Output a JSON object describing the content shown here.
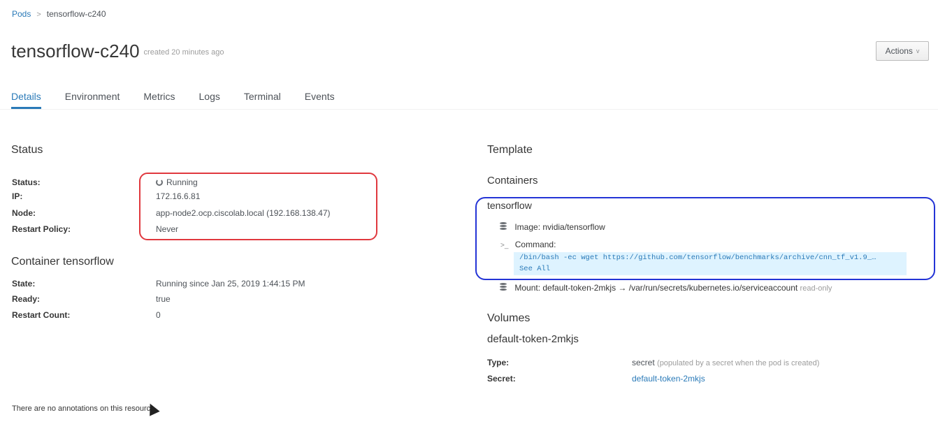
{
  "breadcrumb": {
    "parent": "Pods",
    "separator": ">",
    "current": "tensorflow-c240"
  },
  "header": {
    "title": "tensorflow-c240",
    "created": "created 20 minutes ago",
    "actions_label": "Actions",
    "actions_caret": "v"
  },
  "tabs": [
    {
      "label": "Details",
      "active": true
    },
    {
      "label": "Environment",
      "active": false
    },
    {
      "label": "Metrics",
      "active": false
    },
    {
      "label": "Logs",
      "active": false
    },
    {
      "label": "Terminal",
      "active": false
    },
    {
      "label": "Events",
      "active": false
    }
  ],
  "status_section": {
    "heading": "Status",
    "rows": [
      {
        "label": "Status:",
        "value": "Running"
      },
      {
        "label": "IP:",
        "value": "172.16.6.81"
      },
      {
        "label": "Node:",
        "value": "app-node2.ocp.ciscolab.local (192.168.138.47)"
      },
      {
        "label": "Restart Policy:",
        "value": "Never"
      }
    ]
  },
  "container_section": {
    "heading": "Container tensorflow",
    "rows": [
      {
        "label": "State:",
        "value": "Running since Jan 25, 2019 1:44:15 PM"
      },
      {
        "label": "Ready:",
        "value": "true"
      },
      {
        "label": "Restart Count:",
        "value": "0"
      }
    ]
  },
  "annotations_text": "There are no annotations on this resource.",
  "template": {
    "heading": "Template",
    "containers_heading": "Containers",
    "container_name": "tensorflow",
    "image_label": "Image:",
    "image_value": "nvidia/tensorflow",
    "command_prompt": ">_",
    "command_label": "Command:",
    "command_text": "/bin/bash -ec wget https://github.com/tensorflow/benchmarks/archive/cnn_tf_v1.9_…",
    "see_all": "See All",
    "mount_label": "Mount:",
    "mount_value": "default-token-2mkjs → /var/run/secrets/kubernetes.io/serviceaccount",
    "mount_mode": "read-only"
  },
  "volumes": {
    "heading": "Volumes",
    "name": "default-token-2mkjs",
    "type_label": "Type:",
    "type_value": "secret",
    "type_note": "(populated by a secret when the pod is created)",
    "secret_label": "Secret:",
    "secret_value": "default-token-2mkjs"
  },
  "colors": {
    "link": "#2a7ab8",
    "highlight_red": "#e0383e",
    "highlight_blue": "#2434d6",
    "command_bg": "#def3ff"
  }
}
